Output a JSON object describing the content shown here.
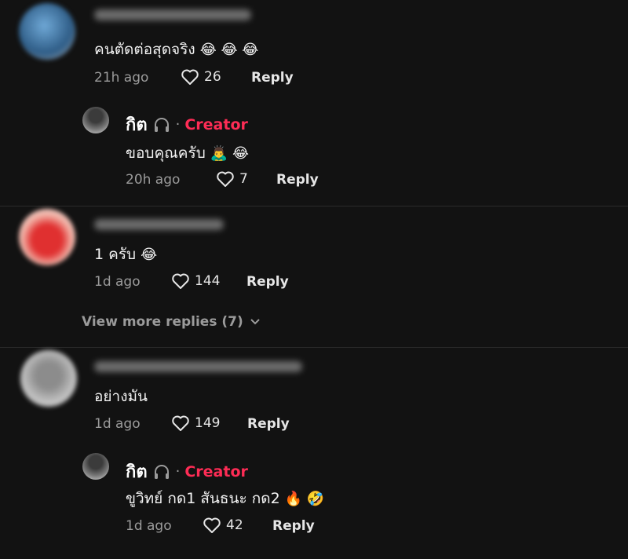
{
  "comments": [
    {
      "text": "คนตัดต่อสุดจริง",
      "emoji": "😂 😂 😂",
      "time": "21h ago",
      "likes": "26",
      "reply_label": "Reply",
      "reply": {
        "name": "กิต",
        "badge": "Creator",
        "text": "ขอบคุณครับ",
        "emoji": "🙇‍♂️ 😂",
        "time": "20h ago",
        "likes": "7",
        "reply_label": "Reply"
      }
    },
    {
      "text": "1 ครับ",
      "emoji": "😂",
      "time": "1d ago",
      "likes": "144",
      "reply_label": "Reply"
    },
    {
      "text": "อย่างมัน",
      "time": "1d ago",
      "likes": "149",
      "reply_label": "Reply",
      "reply": {
        "name": "กิต",
        "badge": "Creator",
        "text": "ขูวิทย์ กด1 สันธนะ กด2",
        "emoji": "🔥 🤣",
        "time": "1d ago",
        "likes": "42",
        "reply_label": "Reply"
      }
    }
  ],
  "view_more": "View more replies (7)",
  "colors": {
    "background": "#121212",
    "creator": "#fe2c55",
    "muted": "#9b9b9b"
  },
  "icons": [
    "heart-outline-icon",
    "headphones-icon",
    "chevron-down-icon"
  ]
}
